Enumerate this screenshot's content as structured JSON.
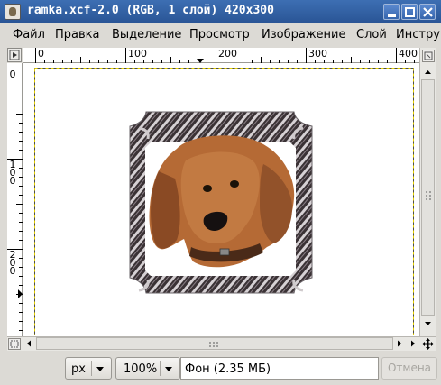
{
  "window": {
    "title": "ramka.xcf-2.0 (RGB, 1 слой) 420x300"
  },
  "menu": {
    "items": [
      {
        "label": "Файл"
      },
      {
        "label": "Правка"
      },
      {
        "label": "Выделение"
      },
      {
        "label": "Просмотр"
      },
      {
        "label": "Изображение"
      },
      {
        "label": "Слой"
      },
      {
        "label": "Инстру"
      }
    ]
  },
  "rulers": {
    "horizontal_ticks": [
      "0",
      "100",
      "200",
      "300",
      "400"
    ],
    "vertical_ticks": [
      "0",
      "100",
      "200"
    ]
  },
  "statusbar": {
    "unit": "px",
    "zoom": "100%",
    "message": "Фон (2.35 МБ)",
    "cancel_label": "Отмена"
  },
  "colors": {
    "titlebar": "#3a6aad",
    "canvas": "#ffffff",
    "guide": "#e6d200"
  }
}
